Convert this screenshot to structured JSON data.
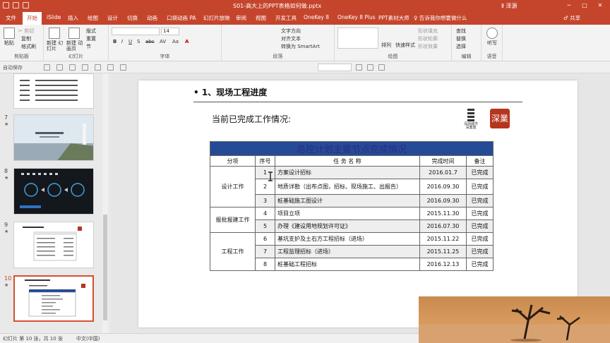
{
  "window": {
    "title": "S01-高大上的PPT表格如何做.pptx",
    "user": "Ⅱ 泽源",
    "controls": [
      "─",
      "□",
      "✕"
    ]
  },
  "tabs": [
    {
      "label": "文件"
    },
    {
      "label": "开始"
    },
    {
      "label": "iSlide"
    },
    {
      "label": "插入"
    },
    {
      "label": "绘图"
    },
    {
      "label": "设计"
    },
    {
      "label": "切换"
    },
    {
      "label": "动画"
    },
    {
      "label": "口袋动画 PA"
    },
    {
      "label": "幻灯片放映"
    },
    {
      "label": "审阅"
    },
    {
      "label": "视图"
    },
    {
      "label": "开发工具"
    },
    {
      "label": "OneKey 8"
    },
    {
      "label": "OneKey 8 Plus"
    },
    {
      "label": "PPT素材大师"
    }
  ],
  "tell_me": "♀ 告诉我你想要做什么",
  "share": "♂ 共享",
  "ribbon": {
    "clipboard": {
      "label": "剪贴板",
      "paste": "粘贴",
      "cut": "✂ 剪切",
      "copy": "复制",
      "format": "格式刷"
    },
    "slides": {
      "label": "幻灯片",
      "new_slide": "新建\n幻灯片",
      "new_anim": "新建\n动画页",
      "layout": "版式",
      "reset": "重置",
      "section": "节"
    },
    "font": {
      "label": "字体",
      "size": "14",
      "bold": "B",
      "italic": "I",
      "underline": "U",
      "shadow": "S",
      "strike": "abc",
      "spacing": "AV",
      "case": "Aa",
      "color": "A"
    },
    "paragraph": {
      "label": "段落",
      "text_dir": "文字方向",
      "align_text": "对齐文本",
      "smartart": "转换为 SmartArt"
    },
    "drawing": {
      "label": "绘图",
      "arrange": "排列",
      "quick_style": "快速样式",
      "fill": "形状填充",
      "outline": "形状轮廓",
      "effect": "形状效果"
    },
    "editing": {
      "label": "编辑",
      "find": "查找",
      "replace": "替换",
      "select": "选择"
    },
    "voice": {
      "label": "语音",
      "dictate": "听写"
    }
  },
  "toolbar2": {
    "autosave": "自动保存"
  },
  "thumbnails": [
    {
      "number": "7"
    },
    {
      "number": "8"
    },
    {
      "number": "9"
    },
    {
      "number": "10",
      "selected": true
    }
  ],
  "slide": {
    "heading": "•   1、现场工程进度",
    "subheading": "当前已完成工作情况:",
    "logo_text": "深業",
    "logo_small": "深圳城市\n深業建",
    "table": {
      "caption": "总控计划主要节点完成情况",
      "headers": [
        "分项",
        "序号",
        "任 务 名 称",
        "完成时间",
        "备注"
      ],
      "rows": [
        {
          "group": "设计工作",
          "num": "1",
          "task": "方案设计招标",
          "date": "2016.01.7",
          "note": "已完成"
        },
        {
          "group": "",
          "num": "2",
          "task": "地质详勘（出布点图，招标、现场施工、出报告）",
          "date": "2016.09.30",
          "note": "已完成"
        },
        {
          "group": "",
          "num": "3",
          "task": "桩基础施工图设计",
          "date": "2016.09.30",
          "note": "已完成"
        },
        {
          "group": "报批报建工作",
          "num": "4",
          "task": "项目立项",
          "date": "2015.11.30",
          "note": "已完成"
        },
        {
          "group": "",
          "num": "5",
          "task": "办理《建设用地规划许可证》",
          "date": "2016.07.30",
          "note": "已完成"
        },
        {
          "group": "工程工作",
          "num": "6",
          "task": "基坑支护及土石方工程招标（进场）",
          "date": "2015.11.22",
          "note": "已完成"
        },
        {
          "group": "",
          "num": "7",
          "task": "工程监理招标（进场）",
          "date": "2015.11.25",
          "note": "已完成"
        },
        {
          "group": "",
          "num": "8",
          "task": "桩基础工程招标",
          "date": "2016.12.13",
          "note": "已完成"
        }
      ]
    }
  },
  "status": {
    "slide_info": "幻灯片 第 10 张，共 10 张",
    "language": "中文(中国)"
  }
}
